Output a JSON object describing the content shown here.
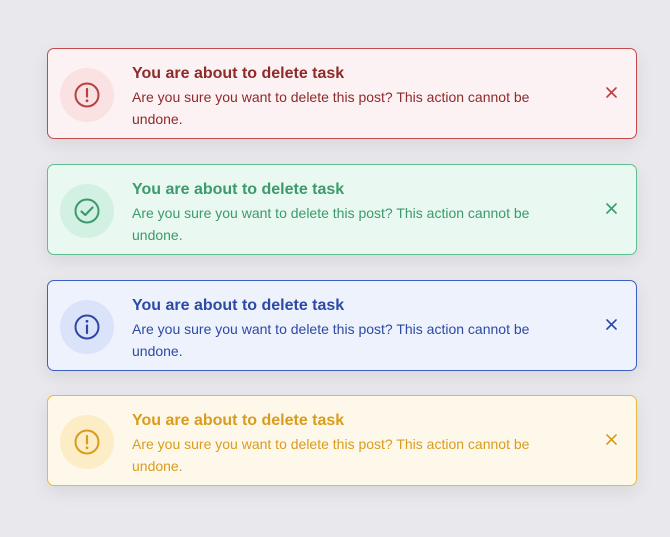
{
  "alerts": [
    {
      "variant": "danger",
      "icon": "exclamation-circle-icon",
      "title": "You are about to delete task",
      "message": "Are you sure you want to delete this post? This action cannot be undone.",
      "accent": "#b84040"
    },
    {
      "variant": "success",
      "icon": "check-circle-icon",
      "title": "You are about to delete task",
      "message": "Are you sure you want to delete this post? This action cannot be undone.",
      "accent": "#3c9a6c"
    },
    {
      "variant": "info",
      "icon": "info-circle-icon",
      "title": "You are about to delete task",
      "message": "Are you sure you want to delete this post? This action cannot be undone.",
      "accent": "#2c4aa4"
    },
    {
      "variant": "warning",
      "icon": "exclamation-circle-icon",
      "title": "You are about to delete task",
      "message": "Are you sure you want to delete this post? This action cannot be undone.",
      "accent": "#d99c1c"
    }
  ]
}
